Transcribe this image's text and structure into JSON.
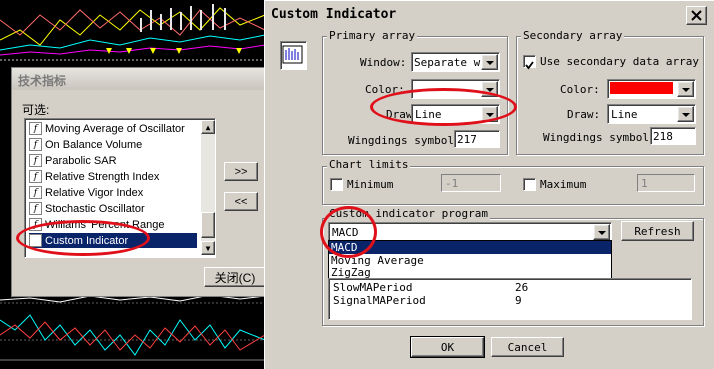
{
  "colors": {
    "title_bg": "#d4d0c8",
    "selection": "#0a246a",
    "annotation": "#e0101a",
    "secondary_color": "#ff0000"
  },
  "background_window": {
    "title": "技术指标",
    "available_label": "可选:",
    "indicators": [
      "Moving Average of Oscillator",
      "On Balance Volume",
      "Parabolic SAR",
      "Relative Strength Index",
      "Relative Vigor Index",
      "Stochastic Oscillator",
      "Williams' Percent Range",
      "Custom Indicator"
    ],
    "selected_indicator": "Custom Indicator",
    "add_button": ">>",
    "remove_button": "<<",
    "close_button": "关闭(C)"
  },
  "dialog": {
    "title": "Custom Indicator",
    "close_icon": "close-icon",
    "primary": {
      "group_label": "Primary array",
      "window_label": "Window:",
      "window_value": "Separate wi",
      "color_label": "Color:",
      "color_value": "",
      "draw_label": "Draw:",
      "draw_value": "Line",
      "wingdings_label": "Wingdings symbol:",
      "wingdings_value": "217"
    },
    "secondary": {
      "group_label": "Secondary array",
      "use_secondary_label": "Use secondary data array",
      "use_secondary_checked": true,
      "color_label": "Color:",
      "draw_label": "Draw:",
      "draw_value": "Line",
      "wingdings_label": "Wingdings symbol:",
      "wingdings_value": "218"
    },
    "limits": {
      "group_label": "Chart limits",
      "minimum_label": "Minimum",
      "minimum_value": "-1",
      "maximum_label": "Maximum",
      "maximum_value": "1"
    },
    "program": {
      "group_label": "Custom indicator program",
      "selected": "MACD",
      "refresh_button": "Refresh",
      "options": [
        "MACD",
        "Moving Average",
        "ZigZag"
      ],
      "params": [
        {
          "name": "SlowMAPeriod",
          "value": "26"
        },
        {
          "name": "SignalMAPeriod",
          "value": "9"
        }
      ]
    },
    "ok_button": "OK",
    "cancel_button": "Cancel"
  }
}
